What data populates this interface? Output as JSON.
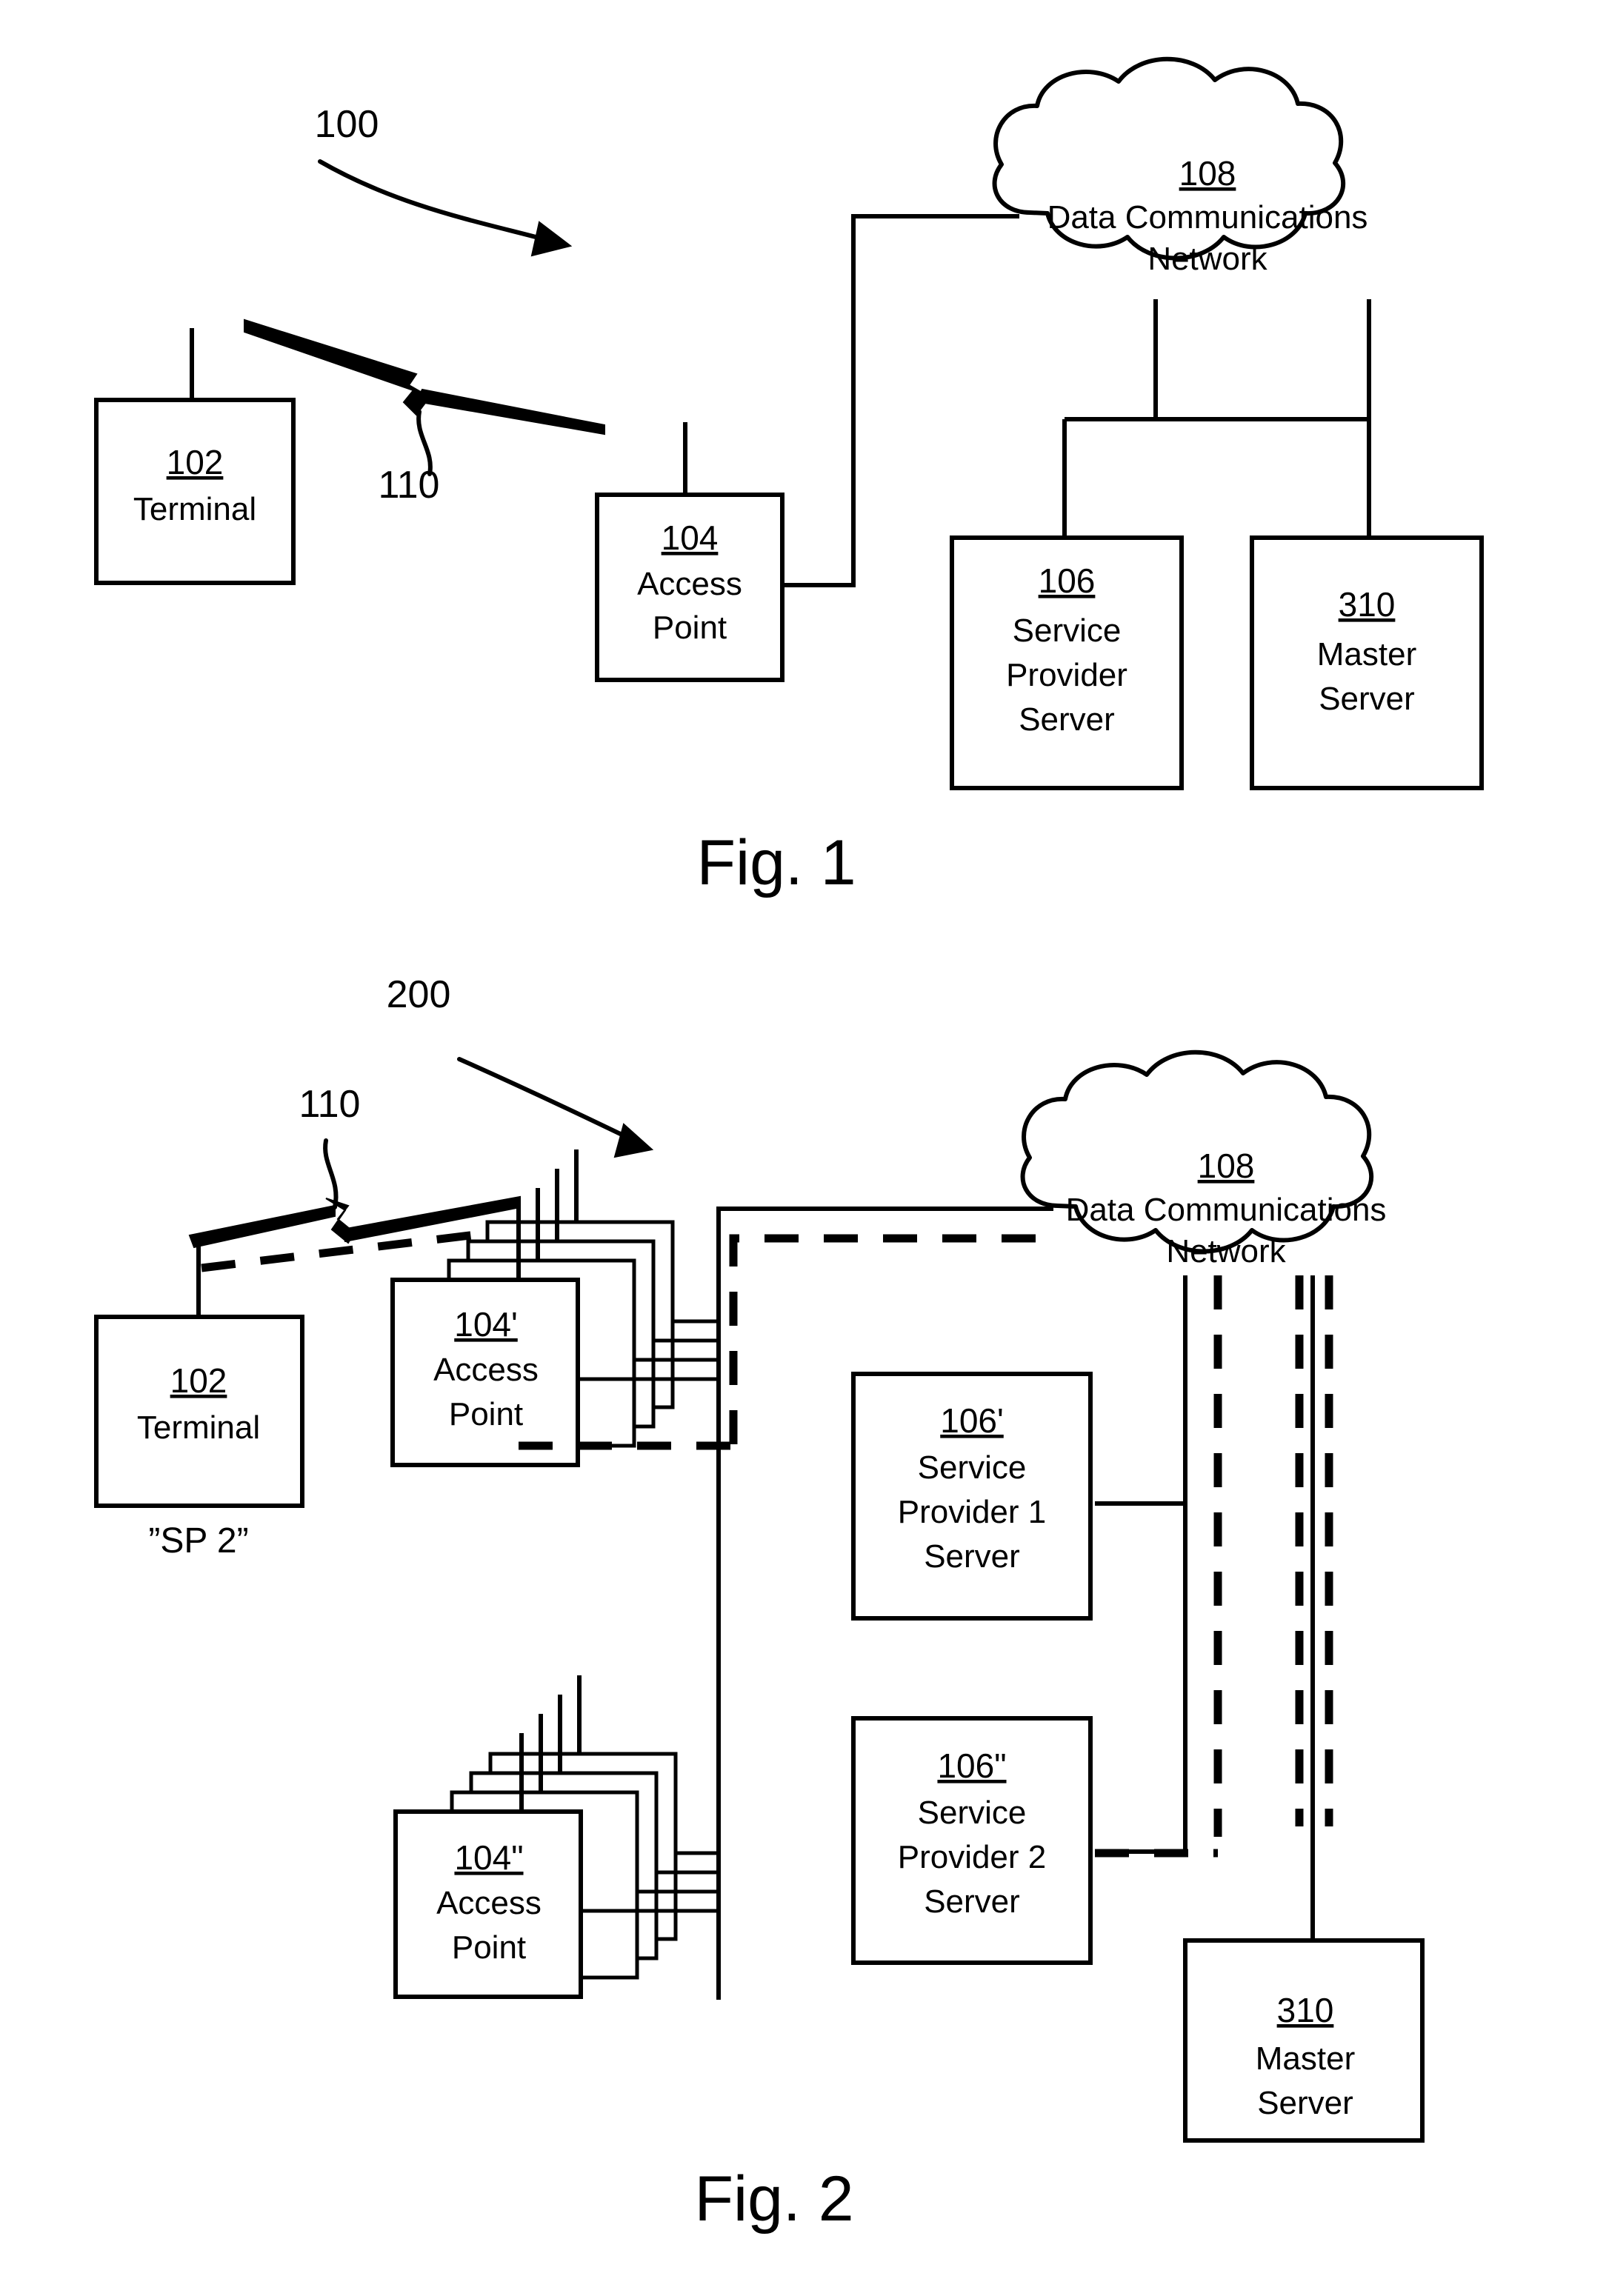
{
  "sheet": {
    "background_color": "#ffffff",
    "ink_color": "#000000"
  },
  "figures": [
    {
      "id": "fig1",
      "caption": "Fig. 1",
      "callout": "100",
      "nodes": [
        {
          "id": "terminal",
          "ref": "102",
          "lines": [
            "Terminal"
          ]
        },
        {
          "id": "access-point",
          "ref": "104",
          "lines": [
            "Access",
            "Point"
          ]
        },
        {
          "id": "network-cloud",
          "ref": "108",
          "lines": [
            "Data Communications",
            "Network"
          ]
        },
        {
          "id": "service-provider-server",
          "ref": "106",
          "lines": [
            "Service",
            "Provider",
            "Server"
          ]
        },
        {
          "id": "master-server",
          "ref": "310",
          "lines": [
            "Master",
            "Server"
          ]
        }
      ],
      "link_labels": [
        {
          "id": "wireless-link",
          "ref": "110"
        }
      ]
    },
    {
      "id": "fig2",
      "caption": "Fig. 2",
      "callout": "200",
      "nodes": [
        {
          "id": "terminal",
          "ref": "102",
          "lines": [
            "Terminal"
          ],
          "tag": "”SP 2”"
        },
        {
          "id": "access-point-1",
          "ref": "104'",
          "lines": [
            "Access",
            "Point"
          ],
          "stacked": 4
        },
        {
          "id": "access-point-2",
          "ref": "104\"",
          "lines": [
            "Access",
            "Point"
          ],
          "stacked": 4
        },
        {
          "id": "network-cloud",
          "ref": "108",
          "lines": [
            "Data Communications",
            "Network"
          ]
        },
        {
          "id": "service-provider-1-server",
          "ref": "106'",
          "lines": [
            "Service",
            "Provider 1",
            "Server"
          ]
        },
        {
          "id": "service-provider-2-server",
          "ref": "106\"",
          "lines": [
            "Service",
            "Provider 2",
            "Server"
          ]
        },
        {
          "id": "master-server",
          "ref": "310",
          "lines": [
            "Master",
            "Server"
          ]
        }
      ],
      "link_labels": [
        {
          "id": "wireless-link",
          "ref": "110"
        }
      ]
    }
  ]
}
